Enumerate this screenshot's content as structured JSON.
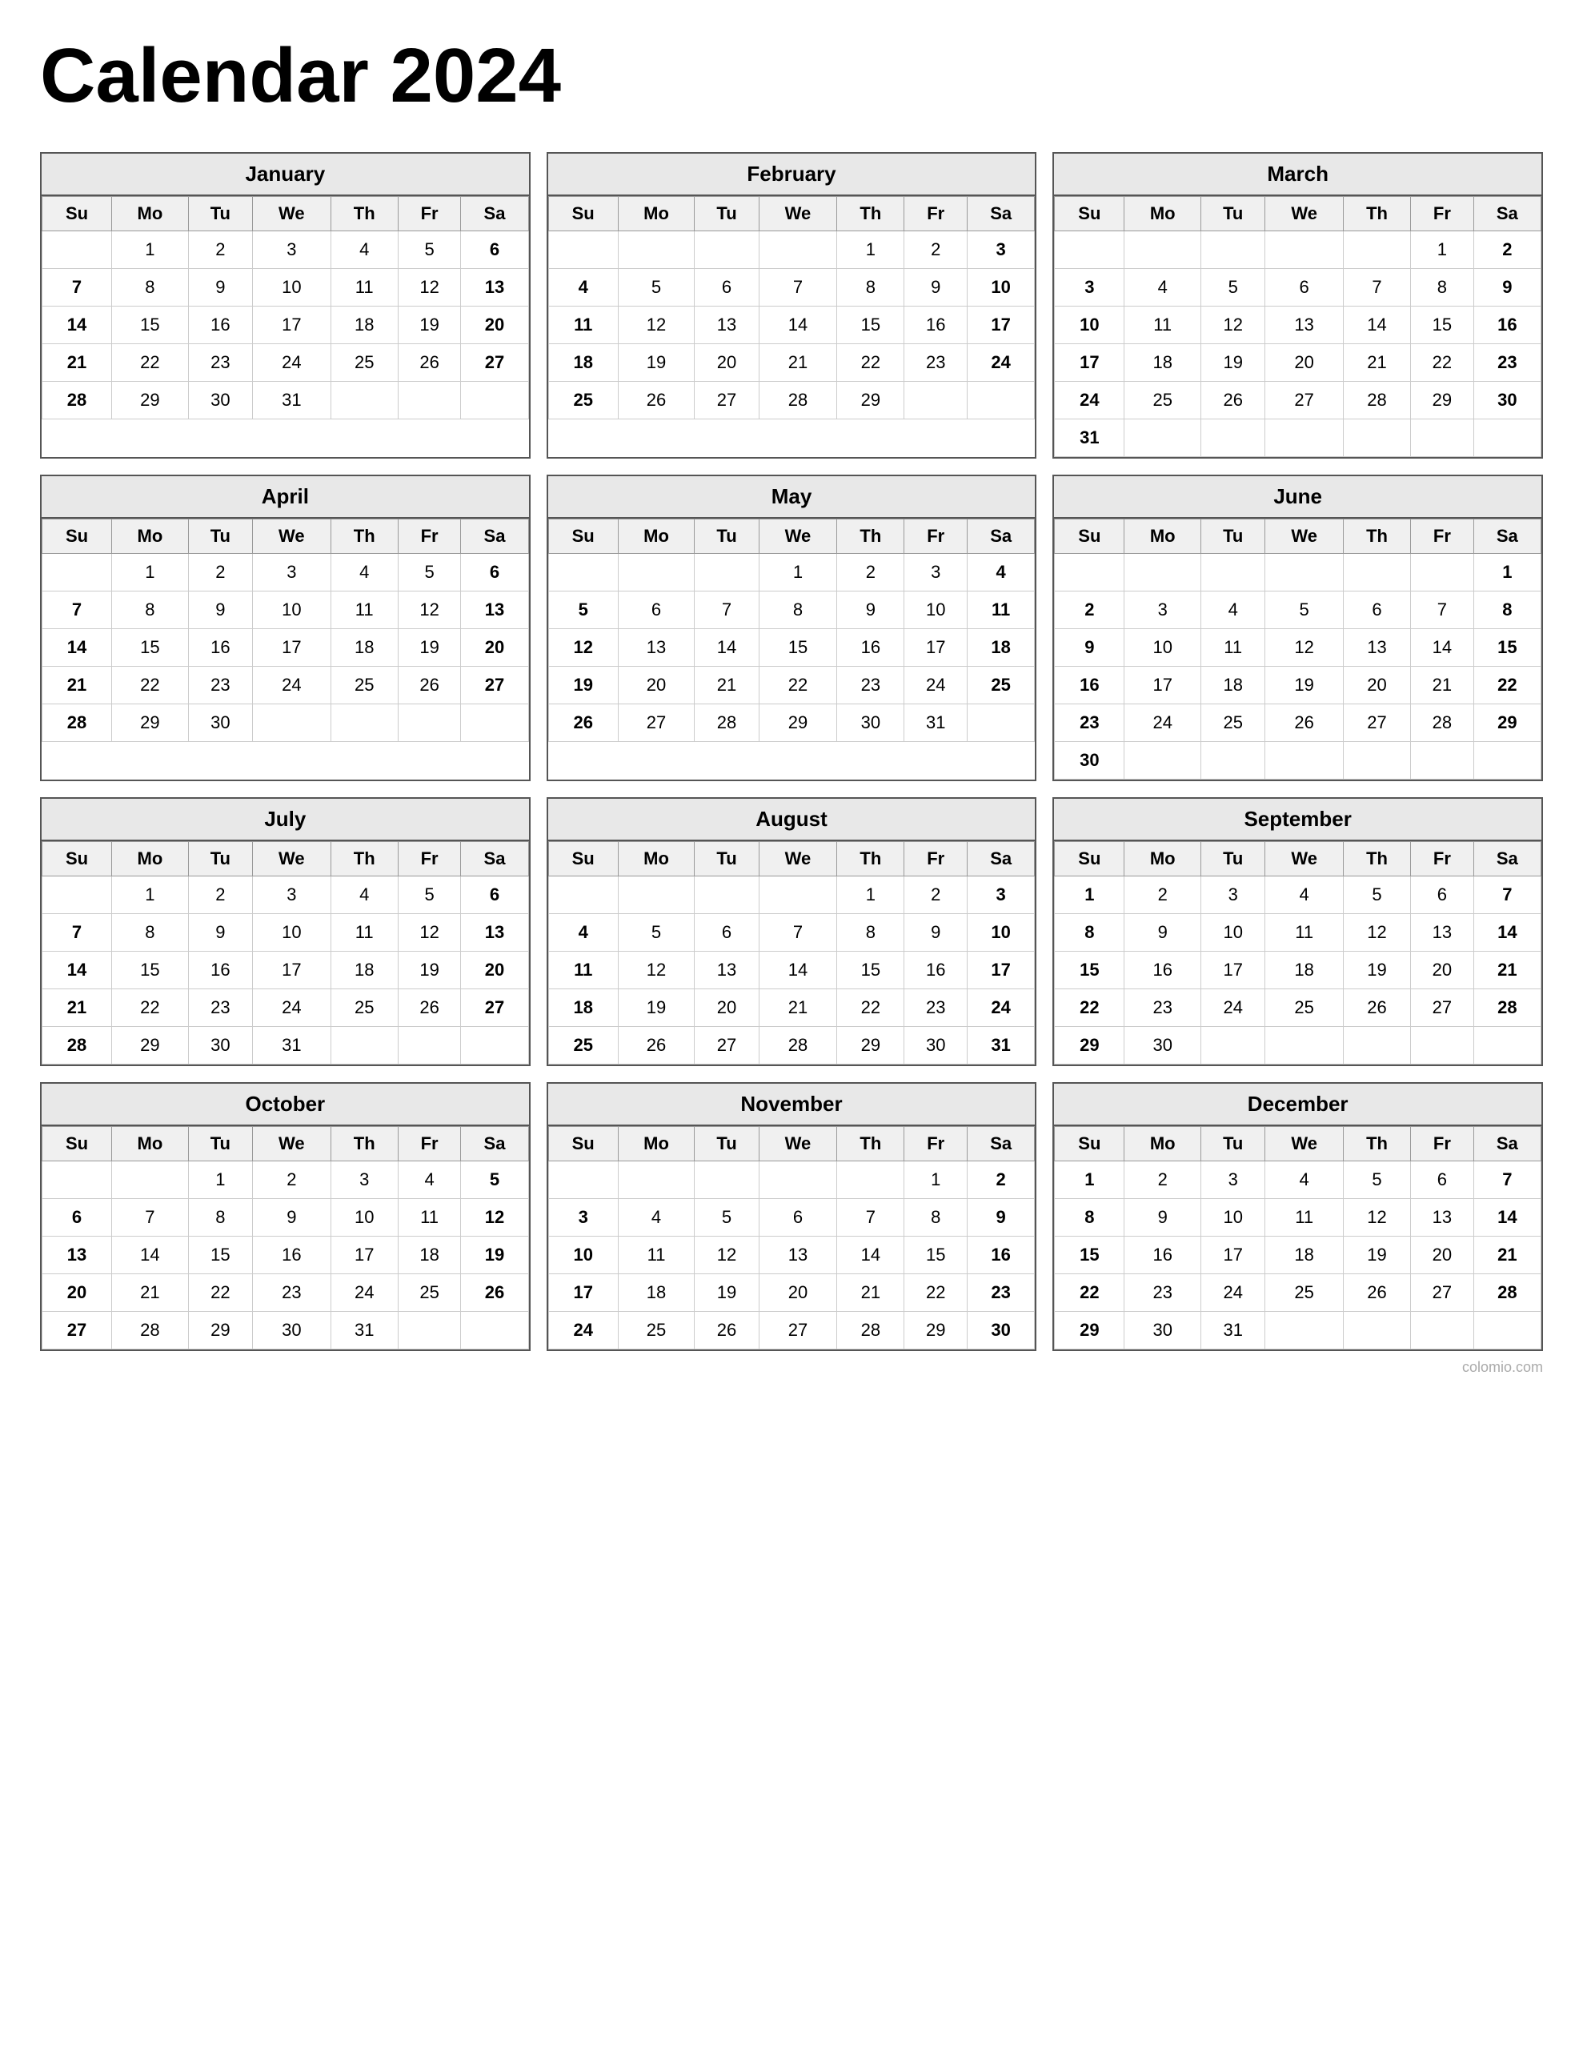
{
  "title": "Calendar 2024",
  "months": [
    {
      "name": "January",
      "weeks": [
        [
          "",
          "1",
          "2",
          "3",
          "4",
          "5",
          "6"
        ],
        [
          "7",
          "8",
          "9",
          "10",
          "11",
          "12",
          "13"
        ],
        [
          "14",
          "15",
          "16",
          "17",
          "18",
          "19",
          "20"
        ],
        [
          "21",
          "22",
          "23",
          "24",
          "25",
          "26",
          "27"
        ],
        [
          "28",
          "29",
          "30",
          "31",
          "",
          "",
          ""
        ]
      ]
    },
    {
      "name": "February",
      "weeks": [
        [
          "",
          "",
          "",
          "",
          "1",
          "2",
          "3"
        ],
        [
          "4",
          "5",
          "6",
          "7",
          "8",
          "9",
          "10"
        ],
        [
          "11",
          "12",
          "13",
          "14",
          "15",
          "16",
          "17"
        ],
        [
          "18",
          "19",
          "20",
          "21",
          "22",
          "23",
          "24"
        ],
        [
          "25",
          "26",
          "27",
          "28",
          "29",
          "",
          ""
        ]
      ]
    },
    {
      "name": "March",
      "weeks": [
        [
          "",
          "",
          "",
          "",
          "",
          "1",
          "2"
        ],
        [
          "3",
          "4",
          "5",
          "6",
          "7",
          "8",
          "9"
        ],
        [
          "10",
          "11",
          "12",
          "13",
          "14",
          "15",
          "16"
        ],
        [
          "17",
          "18",
          "19",
          "20",
          "21",
          "22",
          "23"
        ],
        [
          "24",
          "25",
          "26",
          "27",
          "28",
          "29",
          "30"
        ],
        [
          "31",
          "",
          "",
          "",
          "",
          "",
          ""
        ]
      ]
    },
    {
      "name": "April",
      "weeks": [
        [
          "",
          "1",
          "2",
          "3",
          "4",
          "5",
          "6"
        ],
        [
          "7",
          "8",
          "9",
          "10",
          "11",
          "12",
          "13"
        ],
        [
          "14",
          "15",
          "16",
          "17",
          "18",
          "19",
          "20"
        ],
        [
          "21",
          "22",
          "23",
          "24",
          "25",
          "26",
          "27"
        ],
        [
          "28",
          "29",
          "30",
          "",
          "",
          "",
          ""
        ]
      ]
    },
    {
      "name": "May",
      "weeks": [
        [
          "",
          "",
          "",
          "1",
          "2",
          "3",
          "4"
        ],
        [
          "5",
          "6",
          "7",
          "8",
          "9",
          "10",
          "11"
        ],
        [
          "12",
          "13",
          "14",
          "15",
          "16",
          "17",
          "18"
        ],
        [
          "19",
          "20",
          "21",
          "22",
          "23",
          "24",
          "25"
        ],
        [
          "26",
          "27",
          "28",
          "29",
          "30",
          "31",
          ""
        ]
      ]
    },
    {
      "name": "June",
      "weeks": [
        [
          "",
          "",
          "",
          "",
          "",
          "",
          "1"
        ],
        [
          "2",
          "3",
          "4",
          "5",
          "6",
          "7",
          "8"
        ],
        [
          "9",
          "10",
          "11",
          "12",
          "13",
          "14",
          "15"
        ],
        [
          "16",
          "17",
          "18",
          "19",
          "20",
          "21",
          "22"
        ],
        [
          "23",
          "24",
          "25",
          "26",
          "27",
          "28",
          "29"
        ],
        [
          "30",
          "",
          "",
          "",
          "",
          "",
          ""
        ]
      ]
    },
    {
      "name": "July",
      "weeks": [
        [
          "",
          "1",
          "2",
          "3",
          "4",
          "5",
          "6"
        ],
        [
          "7",
          "8",
          "9",
          "10",
          "11",
          "12",
          "13"
        ],
        [
          "14",
          "15",
          "16",
          "17",
          "18",
          "19",
          "20"
        ],
        [
          "21",
          "22",
          "23",
          "24",
          "25",
          "26",
          "27"
        ],
        [
          "28",
          "29",
          "30",
          "31",
          "",
          "",
          ""
        ]
      ]
    },
    {
      "name": "August",
      "weeks": [
        [
          "",
          "",
          "",
          "",
          "1",
          "2",
          "3"
        ],
        [
          "4",
          "5",
          "6",
          "7",
          "8",
          "9",
          "10"
        ],
        [
          "11",
          "12",
          "13",
          "14",
          "15",
          "16",
          "17"
        ],
        [
          "18",
          "19",
          "20",
          "21",
          "22",
          "23",
          "24"
        ],
        [
          "25",
          "26",
          "27",
          "28",
          "29",
          "30",
          "31"
        ]
      ]
    },
    {
      "name": "September",
      "weeks": [
        [
          "1",
          "2",
          "3",
          "4",
          "5",
          "6",
          "7"
        ],
        [
          "8",
          "9",
          "10",
          "11",
          "12",
          "13",
          "14"
        ],
        [
          "15",
          "16",
          "17",
          "18",
          "19",
          "20",
          "21"
        ],
        [
          "22",
          "23",
          "24",
          "25",
          "26",
          "27",
          "28"
        ],
        [
          "29",
          "30",
          "",
          "",
          "",
          "",
          ""
        ]
      ]
    },
    {
      "name": "October",
      "weeks": [
        [
          "",
          "",
          "1",
          "2",
          "3",
          "4",
          "5"
        ],
        [
          "6",
          "7",
          "8",
          "9",
          "10",
          "11",
          "12"
        ],
        [
          "13",
          "14",
          "15",
          "16",
          "17",
          "18",
          "19"
        ],
        [
          "20",
          "21",
          "22",
          "23",
          "24",
          "25",
          "26"
        ],
        [
          "27",
          "28",
          "29",
          "30",
          "31",
          "",
          ""
        ]
      ]
    },
    {
      "name": "November",
      "weeks": [
        [
          "",
          "",
          "",
          "",
          "",
          "1",
          "2"
        ],
        [
          "3",
          "4",
          "5",
          "6",
          "7",
          "8",
          "9"
        ],
        [
          "10",
          "11",
          "12",
          "13",
          "14",
          "15",
          "16"
        ],
        [
          "17",
          "18",
          "19",
          "20",
          "21",
          "22",
          "23"
        ],
        [
          "24",
          "25",
          "26",
          "27",
          "28",
          "29",
          "30"
        ]
      ]
    },
    {
      "name": "December",
      "weeks": [
        [
          "1",
          "2",
          "3",
          "4",
          "5",
          "6",
          "7"
        ],
        [
          "8",
          "9",
          "10",
          "11",
          "12",
          "13",
          "14"
        ],
        [
          "15",
          "16",
          "17",
          "18",
          "19",
          "20",
          "21"
        ],
        [
          "22",
          "23",
          "24",
          "25",
          "26",
          "27",
          "28"
        ],
        [
          "29",
          "30",
          "31",
          "",
          "",
          "",
          ""
        ]
      ]
    }
  ],
  "days": [
    "Su",
    "Mo",
    "Tu",
    "We",
    "Th",
    "Fr",
    "Sa"
  ],
  "watermark": "colomio.com"
}
